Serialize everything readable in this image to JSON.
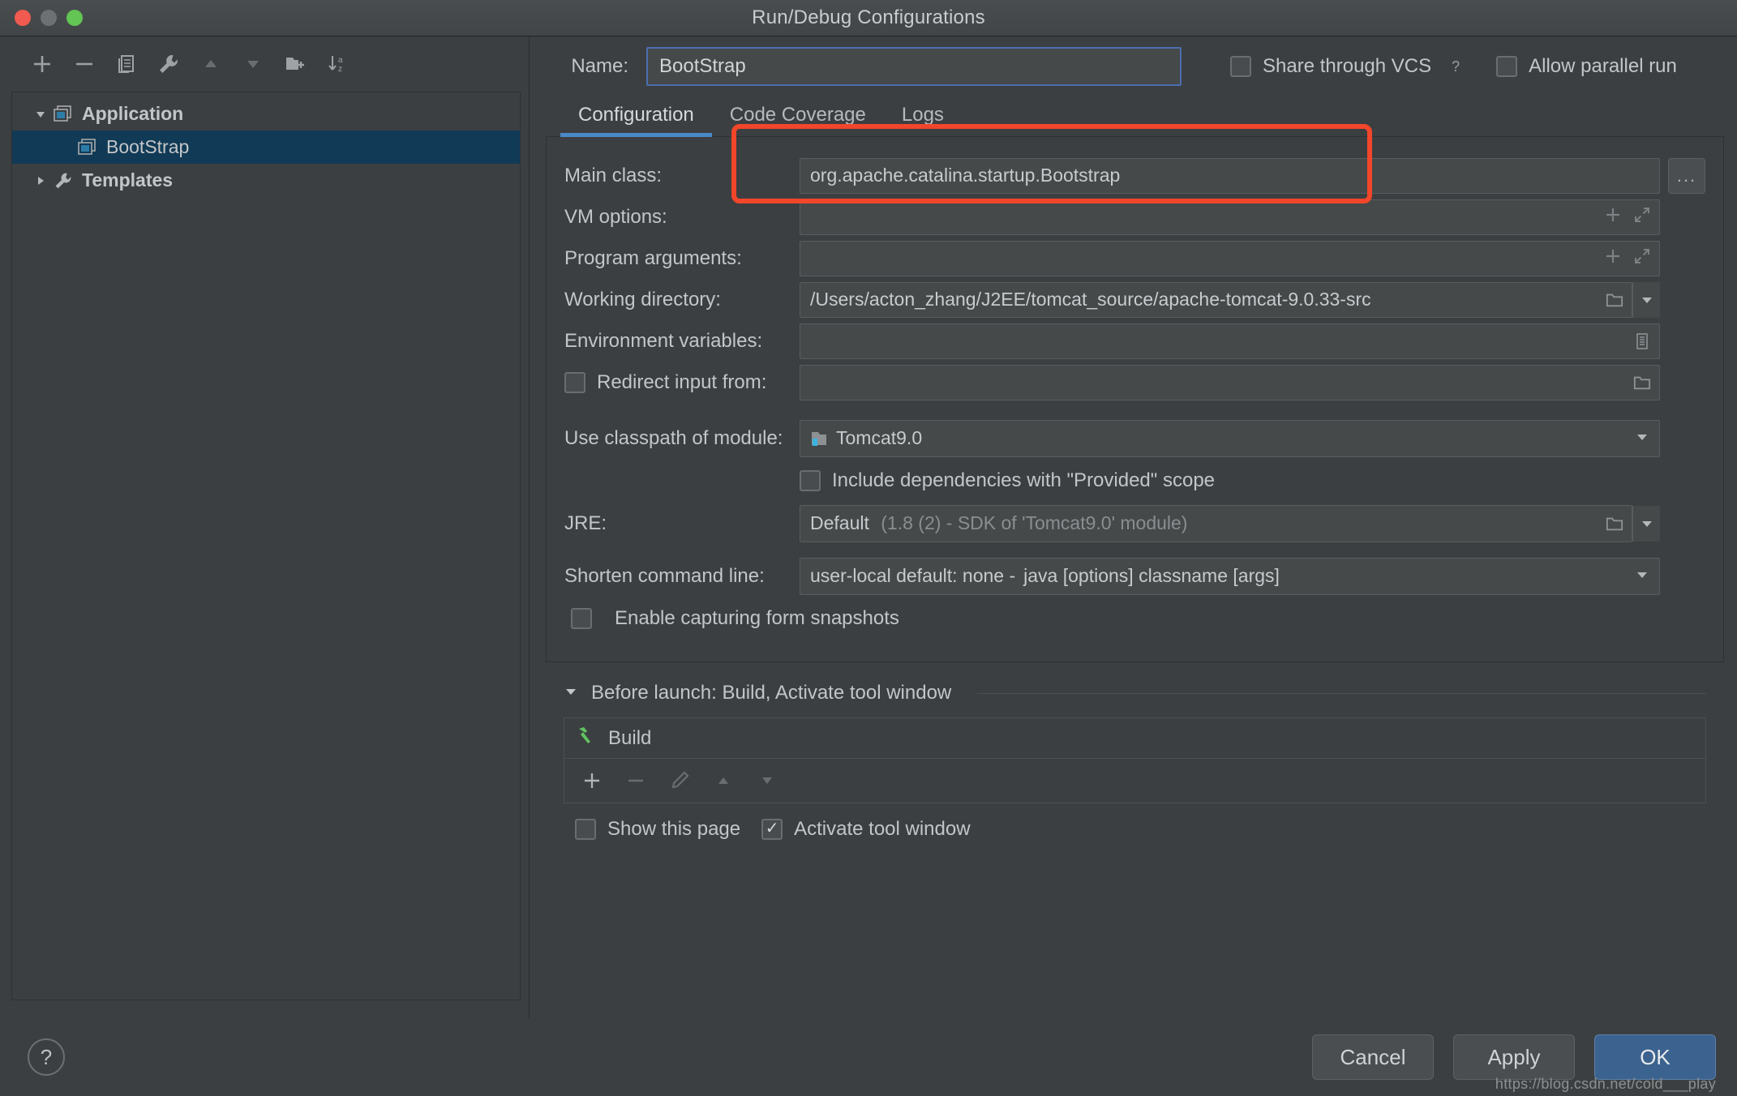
{
  "window": {
    "title": "Run/Debug Configurations",
    "traffic_lights": [
      "close",
      "minimize",
      "zoom"
    ]
  },
  "left_toolbar": [
    {
      "name": "add-configuration-button",
      "icon": "plus-icon",
      "enabled": true
    },
    {
      "name": "remove-configuration-button",
      "icon": "minus-icon",
      "enabled": true
    },
    {
      "name": "copy-configuration-button",
      "icon": "copy-icon",
      "enabled": true
    },
    {
      "name": "edit-templates-button",
      "icon": "wrench-icon",
      "enabled": true
    },
    {
      "name": "move-up-button",
      "icon": "triangle-up-icon",
      "enabled": false
    },
    {
      "name": "move-down-button",
      "icon": "triangle-down-icon",
      "enabled": false
    },
    {
      "name": "create-folder-button",
      "icon": "folder-add-icon",
      "enabled": true
    },
    {
      "name": "sort-alphabetically-button",
      "icon": "sort-az-icon",
      "enabled": true
    }
  ],
  "tree": {
    "items": [
      {
        "label": "Application",
        "icon": "application-icon",
        "twisty": "expanded",
        "bold": true,
        "depth": 0,
        "selected": false
      },
      {
        "label": "BootStrap",
        "icon": "application-icon",
        "twisty": "none",
        "bold": false,
        "depth": 1,
        "selected": true
      },
      {
        "label": "Templates",
        "icon": "wrench-icon",
        "twisty": "collapsed",
        "bold": true,
        "depth": 0,
        "selected": false
      }
    ]
  },
  "header": {
    "name_label": "Name:",
    "name_value": "BootStrap",
    "share_vcs_label": "Share through VCS",
    "share_vcs_checked": false,
    "share_vcs_help_icon": "help-icon",
    "allow_parallel_label": "Allow parallel run",
    "allow_parallel_checked": false
  },
  "tabs": [
    {
      "label": "Configuration",
      "active": true
    },
    {
      "label": "Code Coverage",
      "active": false
    },
    {
      "label": "Logs",
      "active": false
    }
  ],
  "form": {
    "main_class": {
      "label": "Main class:",
      "value": "org.apache.catalina.startup.Bootstrap",
      "browse_label": "...",
      "highlighted": true,
      "highlight_color": "#f2462a"
    },
    "vm_options": {
      "label": "VM options:",
      "value": "",
      "icons": [
        "plus-icon",
        "expand-icon"
      ]
    },
    "program_arguments": {
      "label": "Program arguments:",
      "value": "",
      "icons": [
        "plus-icon",
        "expand-icon"
      ]
    },
    "working_directory": {
      "label": "Working directory:",
      "value": "/Users/acton_zhang/J2EE/tomcat_source/apache-tomcat-9.0.33-src",
      "icons": [
        "folder-icon",
        "chevron-down-icon"
      ]
    },
    "environment_variables": {
      "label": "Environment variables:",
      "value": "",
      "icons": [
        "list-icon"
      ]
    },
    "redirect_input": {
      "label": "Redirect input from:",
      "checked": false,
      "value": "",
      "icons": [
        "folder-icon"
      ]
    },
    "use_classpath_of_module": {
      "label": "Use classpath of module:",
      "value": "Tomcat9.0",
      "icon": "module-icon",
      "caret": "chevron-down-icon"
    },
    "include_provided": {
      "label": "Include dependencies with \"Provided\" scope",
      "checked": false
    },
    "jre": {
      "label": "JRE:",
      "value": "Default",
      "value_dim": "(1.8 (2) - SDK of 'Tomcat9.0' module)",
      "icons": [
        "folder-icon",
        "chevron-down-icon"
      ]
    },
    "shorten_command_line": {
      "label": "Shorten command line:",
      "value": "user-local default: none -",
      "value_dim": "java [options] classname [args]",
      "caret": "chevron-down-icon"
    },
    "enable_capturing": {
      "label": "Enable capturing form snapshots",
      "checked": false
    }
  },
  "before_launch": {
    "header": "Before launch: Build, Activate tool window",
    "twisty": "expanded",
    "items": [
      {
        "label": "Build",
        "icon": "hammer-icon"
      }
    ],
    "toolbar": [
      {
        "name": "add-task-button",
        "icon": "plus-icon",
        "enabled": true
      },
      {
        "name": "remove-task-button",
        "icon": "minus-icon",
        "enabled": false
      },
      {
        "name": "edit-task-button",
        "icon": "pencil-icon",
        "enabled": false
      },
      {
        "name": "move-task-up-button",
        "icon": "triangle-up-icon",
        "enabled": false
      },
      {
        "name": "move-task-down-button",
        "icon": "triangle-down-icon",
        "enabled": false
      }
    ],
    "show_this_page": {
      "label": "Show this page",
      "checked": false
    },
    "activate_tool_window": {
      "label": "Activate tool window",
      "checked": true
    }
  },
  "footer": {
    "help_icon": "question-icon",
    "cancel_label": "Cancel",
    "apply_label": "Apply",
    "ok_label": "OK",
    "watermark": "https://blog.csdn.net/cold___play"
  }
}
